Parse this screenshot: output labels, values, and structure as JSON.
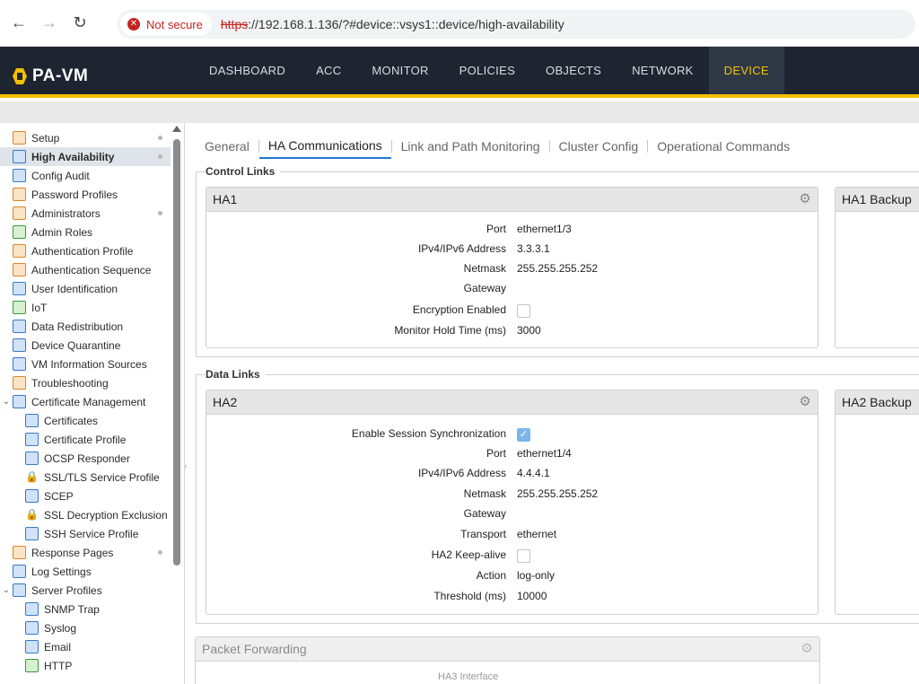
{
  "browser": {
    "security_label": "Not secure",
    "url_protocol": "https",
    "url_rest": "://192.168.1.136/?#device::vsys1::device/high-availability"
  },
  "app": {
    "logo_text": "PA-VM",
    "nav": [
      "DASHBOARD",
      "ACC",
      "MONITOR",
      "POLICIES",
      "OBJECTS",
      "NETWORK",
      "DEVICE"
    ]
  },
  "sidebar": {
    "items": [
      {
        "label": "Setup"
      },
      {
        "label": "High Availability"
      },
      {
        "label": "Config Audit"
      },
      {
        "label": "Password Profiles"
      },
      {
        "label": "Administrators"
      },
      {
        "label": "Admin Roles"
      },
      {
        "label": "Authentication Profile"
      },
      {
        "label": "Authentication Sequence"
      },
      {
        "label": "User Identification"
      },
      {
        "label": "IoT"
      },
      {
        "label": "Data Redistribution"
      },
      {
        "label": "Device Quarantine"
      },
      {
        "label": "VM Information Sources"
      },
      {
        "label": "Troubleshooting"
      },
      {
        "label": "Certificate Management"
      },
      {
        "label": "Certificates"
      },
      {
        "label": "Certificate Profile"
      },
      {
        "label": "OCSP Responder"
      },
      {
        "label": "SSL/TLS Service Profile"
      },
      {
        "label": "SCEP"
      },
      {
        "label": "SSL Decryption Exclusion"
      },
      {
        "label": "SSH Service Profile"
      },
      {
        "label": "Response Pages"
      },
      {
        "label": "Log Settings"
      },
      {
        "label": "Server Profiles"
      },
      {
        "label": "SNMP Trap"
      },
      {
        "label": "Syslog"
      },
      {
        "label": "Email"
      },
      {
        "label": "HTTP"
      }
    ]
  },
  "tabs": [
    "General",
    "HA Communications",
    "Link and Path Monitoring",
    "Cluster Config",
    "Operational Commands"
  ],
  "control_links": {
    "legend": "Control Links",
    "ha1": {
      "title": "HA1",
      "port_label": "Port",
      "port": "ethernet1/3",
      "ip_label": "IPv4/IPv6 Address",
      "ip": "3.3.3.1",
      "netmask_label": "Netmask",
      "netmask": "255.255.255.252",
      "gateway_label": "Gateway",
      "encryption_label": "Encryption Enabled",
      "monitor_label": "Monitor Hold Time (ms)",
      "monitor": "3000"
    },
    "ha1_backup_title": "HA1 Backup"
  },
  "data_links": {
    "legend": "Data Links",
    "ha2": {
      "title": "HA2",
      "sync_label": "Enable Session Synchronization",
      "port_label": "Port",
      "port": "ethernet1/4",
      "ip_label": "IPv4/IPv6 Address",
      "ip": "4.4.4.1",
      "netmask_label": "Netmask",
      "netmask": "255.255.255.252",
      "gateway_label": "Gateway",
      "transport_label": "Transport",
      "transport": "ethernet",
      "keepalive_label": "HA2 Keep-alive",
      "action_label": "Action",
      "action": "log-only",
      "threshold_label": "Threshold (ms)",
      "threshold": "10000"
    },
    "ha2_backup_title": "HA2 Backup"
  },
  "packet_forwarding": {
    "title": "Packet Forwarding",
    "ha3_label": "HA3 Interface"
  }
}
